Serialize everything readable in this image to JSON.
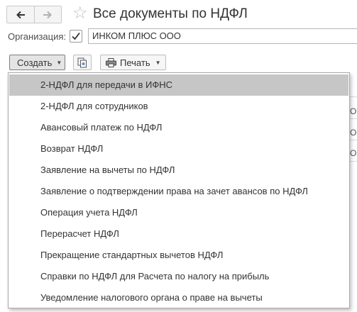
{
  "header": {
    "title": "Все документы по НДФЛ",
    "back_icon": "arrow-left-icon",
    "forward_icon": "arrow-right-icon",
    "favorite_icon": "star-icon"
  },
  "organization": {
    "label": "Организация:",
    "checked": true,
    "value": "ИНКОМ ПЛЮС ООО"
  },
  "toolbar": {
    "create_label": "Создать",
    "copy_icon": "copy-document-icon",
    "print_label": "Печать"
  },
  "menu": {
    "items": [
      {
        "label": "2-НДФЛ для передачи в ИФНС",
        "active": true
      },
      {
        "label": "2-НДФЛ для сотрудников"
      },
      {
        "label": "Авансовый платеж по НДФЛ"
      },
      {
        "label": "Возврат НДФЛ"
      },
      {
        "label": "Заявление на вычеты по НДФЛ"
      },
      {
        "label": "Заявление о подтверждении права на зачет авансов по НДФЛ"
      },
      {
        "label": "Операция учета НДФЛ"
      },
      {
        "label": "Перерасчет НДФЛ"
      },
      {
        "label": "Прекращение стандартных вычетов НДФЛ"
      },
      {
        "label": "Справки по НДФЛ для Расчета по налогу на прибыль"
      },
      {
        "label": "Уведомление налогового органа о праве на вычеты"
      }
    ]
  },
  "background_list": {
    "row_chars": [
      "О",
      "О",
      "О"
    ]
  },
  "colors": {
    "active_item": "#c6c6c6",
    "create_button": "#e4e4e4"
  }
}
